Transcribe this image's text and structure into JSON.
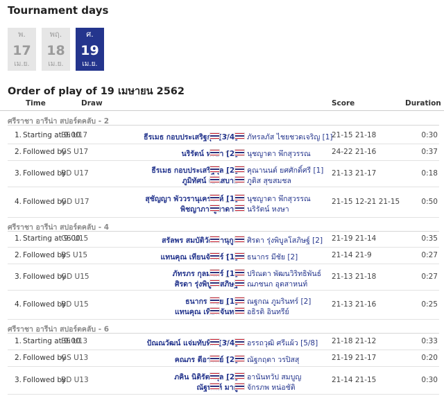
{
  "page": {
    "section_title": "Tournament days",
    "order_title": "Order of play of 19 เมษายน 2562"
  },
  "days": [
    {
      "weekday": "พ.",
      "day": "17",
      "month": "เม.ย.",
      "active": false
    },
    {
      "weekday": "พฤ.",
      "day": "18",
      "month": "เม.ย.",
      "active": false
    },
    {
      "weekday": "ศ.",
      "day": "19",
      "month": "เม.ย.",
      "active": true
    }
  ],
  "table": {
    "headers": {
      "time": "Time",
      "draw": "Draw",
      "score": "Score",
      "duration": "Duration"
    }
  },
  "colors": {
    "accent": "#24358d",
    "flag_red": "#cc2233",
    "flag_white": "#ffffff",
    "flag_blue": "#2a2f7a"
  },
  "groups": [
    {
      "name": "ศรีราชา อารีน่า สปอร์ตคลับ - 2",
      "matches": [
        {
          "num": "1.",
          "time": "Starting at 9:00",
          "draw": "BS U17",
          "team1": [
            "ธีรเมธ กอบประเสริฐกุล [3/4]"
          ],
          "team2": [
            "ภัทรลภัส ไชยชวดเจริญ [1]"
          ],
          "score": "21-15 21-18",
          "duration": "0:30"
        },
        {
          "num": "2.",
          "time": "Followed by",
          "draw": "GS U17",
          "team1": [
            "นริรัตน์ หงษา [2]"
          ],
          "team2": [
            "นุชญาดา พึกสุวรรณ"
          ],
          "score": "24-22 21-16",
          "duration": "0:37"
        },
        {
          "num": "3.",
          "time": "Followed by",
          "draw": "BD U17",
          "team1": [
            "ธีรเมธ กอบประเสริฐกุล [2]",
            "ภูมิทัศน์ เย็นสบาย"
          ],
          "team2": [
            "คุณานนต์ ยศศักดิ์ศรี [1]",
            "ภูติส สุขสมชล"
          ],
          "score": "21-13 21-17",
          "duration": "0:18"
        },
        {
          "num": "4.",
          "time": "Followed by",
          "draw": "GD U17",
          "team1": [
            "สุชัญญา พัววรานุเคราะห์ [1]",
            "พิชญาภา ภูยาดาว"
          ],
          "team2": [
            "นุชญาดา พึกสุวรรณ",
            "นริรัตน์ หงษา"
          ],
          "score": "21-15 12-21 21-15",
          "duration": "0:50"
        }
      ]
    },
    {
      "name": "ศรีราชา อารีน่า สปอร์ตคลับ - 4",
      "matches": [
        {
          "num": "1.",
          "time": "Starting at 9:00",
          "draw": "GS U15",
          "team1": [
            "สรัลพร สมบัติวัฒนานุกูล"
          ],
          "team2": [
            "ศิรดา รุ่งพิบูลโสภิษฐ์ [2]"
          ],
          "score": "21-19 21-14",
          "duration": "0:35"
        },
        {
          "num": "2.",
          "time": "Followed by",
          "draw": "BS U15",
          "team1": [
            "แทนคุณ เทียนจันทร์ [1]"
          ],
          "team2": [
            "ธนากร มีชัย [2]"
          ],
          "score": "21-14 21-9",
          "duration": "0:27"
        },
        {
          "num": "3.",
          "time": "Followed by",
          "draw": "GD U15",
          "team1": [
            "ภัทรภร กุลมาตร์ [1]",
            "ศิรดา รุ่งพิบูลโสภิษฐ์"
          ],
          "team2": [
            "ปริณดา พัฒนวิริทธิพันธ์",
            "ณภชนก อุตสาหนท์"
          ],
          "score": "21-13 21-18",
          "duration": "0:27"
        },
        {
          "num": "4.",
          "time": "Followed by",
          "draw": "BD U15",
          "team1": [
            "ธนากร มีชัย [1]",
            "แทนคุณ เทียนจันทร์"
          ],
          "team2": [
            "ณฐกณ ภูมรินทร์ [2]",
            "อธิรติ อินทรีย์"
          ],
          "score": "21-13 21-16",
          "duration": "0:25"
        }
      ]
    },
    {
      "name": "ศรีราชา อารีน่า สปอร์ตคลับ - 6",
      "matches": [
        {
          "num": "1.",
          "time": "Starting at 9:00",
          "draw": "BS U13",
          "team1": [
            "ปัณณวัฒน์ แจ่มทับทิม [3/4]"
          ],
          "team2": [
            "อรรถวุฒิ ศรีแผ้ว [5/8]"
          ],
          "score": "21-18 21-12",
          "duration": "0:33"
        },
        {
          "num": "2.",
          "time": "Followed by",
          "draw": "GS U13",
          "team1": [
            "คณภร ตีอารมย์ [2]"
          ],
          "team2": [
            "ณัฐกฤตา วรปิสสุ"
          ],
          "score": "21-19 21-17",
          "duration": "0:20"
        },
        {
          "num": "3.",
          "time": "Followed by",
          "draw": "BD U13",
          "team1": [
            "ภคิน นิติรัตนกุล [2]",
            "ณัฐนนท์ มากู่"
          ],
          "team2": [
            "อานันทวัป สมบูญ",
            "จักรภพ หน่อชัติ"
          ],
          "score": "21-14 21-15",
          "duration": "0:30"
        }
      ]
    }
  ]
}
